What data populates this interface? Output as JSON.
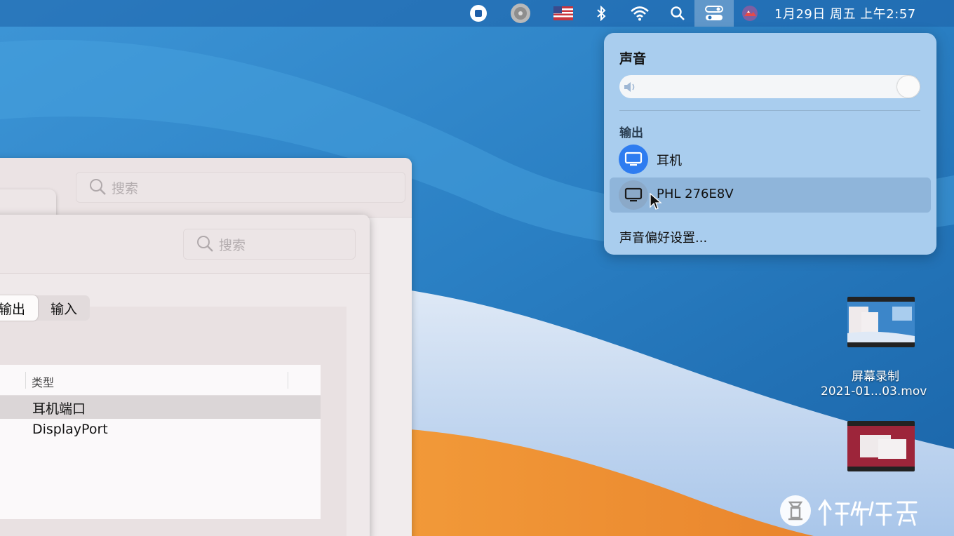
{
  "menubar": {
    "clock": "1月29日 周五 上午2:57",
    "icons": [
      "stop-recording-icon",
      "disk-icon",
      "us-flag-icon",
      "bluetooth-icon",
      "wifi-icon",
      "search-icon",
      "control-center-icon",
      "app-status-icon"
    ]
  },
  "sound_popover": {
    "title": "声音",
    "volume": 1.0,
    "output_section": "输出",
    "outputs": [
      {
        "label": "耳机",
        "selected": true
      },
      {
        "label": "PHL 276E8V",
        "selected": false
      }
    ],
    "preferences_link": "声音偏好设置..."
  },
  "back_window": {
    "search_placeholder": "搜索"
  },
  "front_window": {
    "search_placeholder": "搜索",
    "tabs": [
      {
        "label": "输出",
        "active": true
      },
      {
        "label": "输入",
        "active": false
      }
    ],
    "table": {
      "header": "类型",
      "rows": [
        "耳机端口",
        "DisplayPort"
      ]
    }
  },
  "desktop": {
    "files": [
      {
        "name_line1": "屏幕录制",
        "name_line2": "2021-01...03.mov"
      }
    ]
  },
  "colors": {
    "accent_blue": "#2e7cf0",
    "wallpaper_blue": "#1e6fb5",
    "wallpaper_orange": "#ef8b2e",
    "popover_bg": "#a9cdee"
  }
}
